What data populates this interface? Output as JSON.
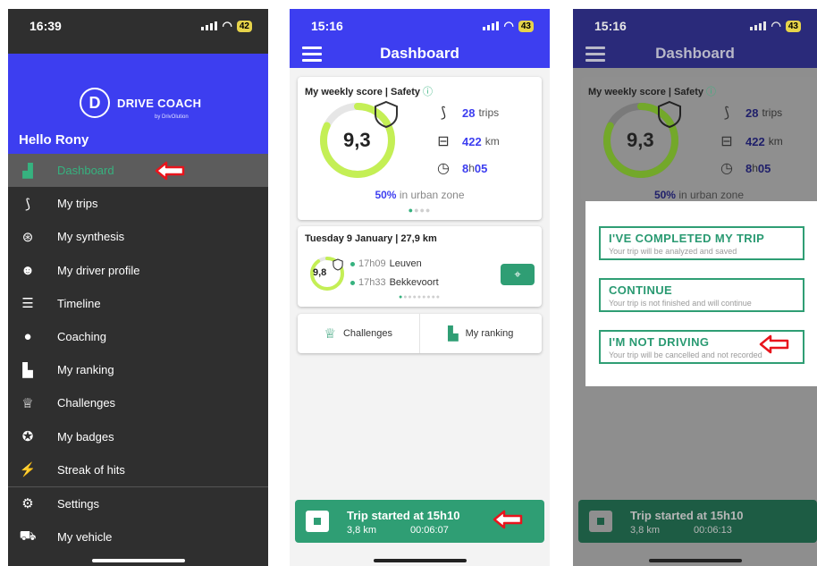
{
  "screens": [
    {
      "status": {
        "time": "16:39",
        "battery": "42"
      },
      "brand": {
        "badge": "D",
        "name": "DRIVE COACH",
        "sub": "by DrivOlution"
      },
      "greeting": "Hello Rony",
      "menu": [
        {
          "label": "Dashboard",
          "icon": "bar-chart-icon",
          "glyph": "▟"
        },
        {
          "label": "My trips",
          "icon": "route-icon",
          "glyph": "⟆"
        },
        {
          "label": "My synthesis",
          "icon": "steering-wheel-icon",
          "glyph": "⊛"
        },
        {
          "label": "My driver profile",
          "icon": "person-icon",
          "glyph": "☻"
        },
        {
          "label": "Timeline",
          "icon": "timeline-icon",
          "glyph": "☰"
        },
        {
          "label": "Coaching",
          "icon": "chat-bubble-icon",
          "glyph": "●"
        },
        {
          "label": "My ranking",
          "icon": "podium-icon",
          "glyph": "▙"
        },
        {
          "label": "Challenges",
          "icon": "trophy-icon",
          "glyph": "♕"
        },
        {
          "label": "My badges",
          "icon": "medal-icon",
          "glyph": "✪"
        },
        {
          "label": "Streak of hits",
          "icon": "stairs-icon",
          "glyph": "⚡"
        },
        {
          "label": "Settings",
          "icon": "gear-icon",
          "glyph": "⚙"
        },
        {
          "label": "My vehicle",
          "icon": "car-icon",
          "glyph": "⛟"
        }
      ]
    },
    {
      "status": {
        "time": "15:16",
        "battery": "43"
      },
      "title": "Dashboard",
      "weekly": {
        "title": "My weekly score | Safety",
        "score": "9,3",
        "trips": "28",
        "trips_unit": "trips",
        "distance": "422",
        "distance_unit": "km",
        "duration_h": "8",
        "duration_sep": "h",
        "duration_m": "05",
        "urban_pct": "50%",
        "urban_text": "in urban zone",
        "score_fraction": 0.82
      },
      "last_trip": {
        "title": "Tuesday 9 January | 27,9 km",
        "score": "9,8",
        "start_time": "17h09",
        "start_place": "Leuven",
        "end_time": "17h33",
        "end_place": "Bekkevoort",
        "score_fraction": 0.9
      },
      "links": {
        "challenges": "Challenges",
        "ranking": "My ranking"
      },
      "trip_bar": {
        "title": "Trip started at 15h10",
        "distance": "3,8 km",
        "elapsed": "00:06:07"
      }
    },
    {
      "status": {
        "time": "15:16",
        "battery": "43"
      },
      "title": "Dashboard",
      "weekly": {
        "title": "My weekly score | Safety",
        "score": "9,3",
        "trips": "28",
        "trips_unit": "trips",
        "distance": "422",
        "distance_unit": "km",
        "duration_h": "8",
        "duration_sep": "h",
        "duration_m": "05",
        "urban_pct": "50%",
        "urban_text": "in urban zone"
      },
      "options": [
        {
          "title": "I'VE COMPLETED MY TRIP",
          "sub": "Your trip will be analyzed and saved"
        },
        {
          "title": "CONTINUE",
          "sub": "Your trip is not finished and will continue"
        },
        {
          "title": "I'M NOT DRIVING",
          "sub": "Your trip will be cancelled and not recorded"
        }
      ],
      "trip_bar": {
        "title": "Trip started at 15h10",
        "distance": "3,8 km",
        "elapsed": "00:06:13"
      }
    }
  ],
  "colors": {
    "primary": "#3d3ef0",
    "accent": "#2f9e74",
    "arrow": "#e8141c"
  }
}
